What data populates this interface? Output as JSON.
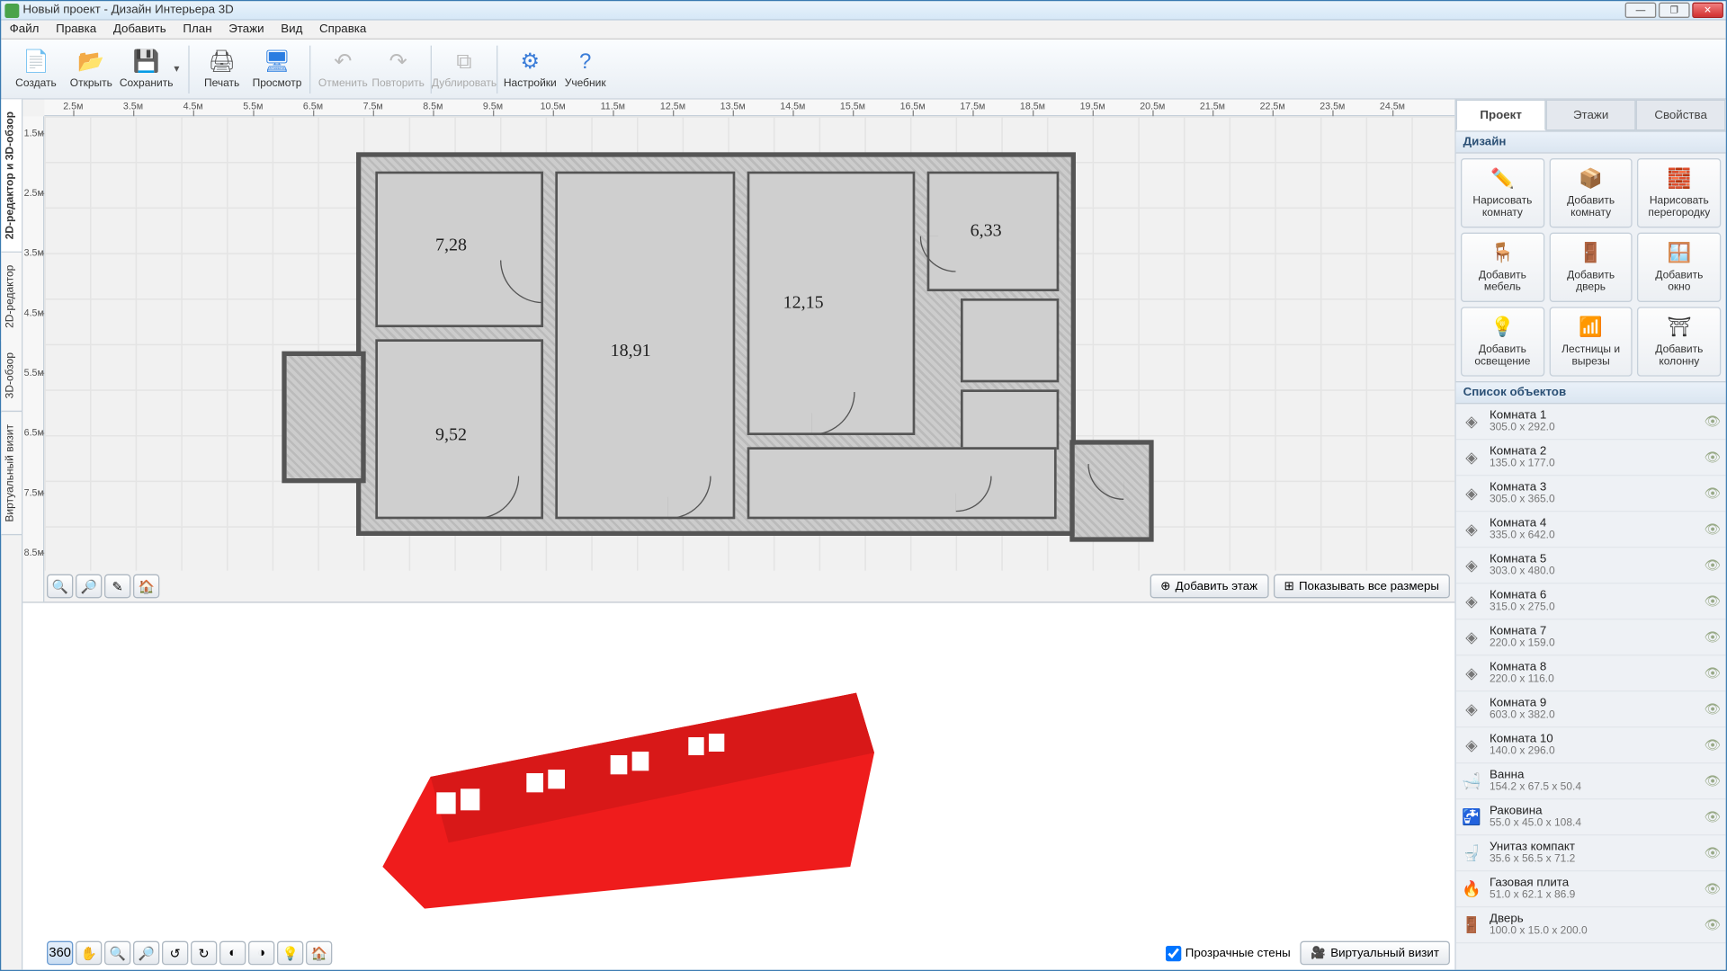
{
  "window": {
    "title": "Новый проект - Дизайн Интерьера 3D"
  },
  "menus": [
    "Файл",
    "Правка",
    "Добавить",
    "План",
    "Этажи",
    "Вид",
    "Справка"
  ],
  "toolbar": [
    {
      "id": "new",
      "label": "Создать",
      "icon": "📄",
      "color": "#2b7de1"
    },
    {
      "id": "open",
      "label": "Открыть",
      "icon": "📂",
      "color": "#e6a23c"
    },
    {
      "id": "save",
      "label": "Сохранить",
      "icon": "💾",
      "color": "#3b6fb5",
      "dropdown": true,
      "sep": true
    },
    {
      "id": "print",
      "label": "Печать",
      "icon": "🖨",
      "color": "#555"
    },
    {
      "id": "preview",
      "label": "Просмотр",
      "icon": "🖥",
      "color": "#2b7de1",
      "sep": true
    },
    {
      "id": "undo",
      "label": "Отменить",
      "icon": "↶",
      "color": "#bbb",
      "disabled": true
    },
    {
      "id": "redo",
      "label": "Повторить",
      "icon": "↷",
      "color": "#bbb",
      "disabled": true,
      "sep": true
    },
    {
      "id": "dup",
      "label": "Дублировать",
      "icon": "⧉",
      "color": "#bbb",
      "disabled": true,
      "sep": true
    },
    {
      "id": "settings",
      "label": "Настройки",
      "icon": "⚙",
      "color": "#3b7dd8"
    },
    {
      "id": "help",
      "label": "Учебник",
      "icon": "?",
      "color": "#3b7dd8"
    }
  ],
  "leftTabs": [
    {
      "id": "combined",
      "label": "2D-редактор и 3D-обзор",
      "active": true
    },
    {
      "id": "2d",
      "label": "2D-редактор"
    },
    {
      "id": "3d",
      "label": "3D-обзор"
    },
    {
      "id": "virtual",
      "label": "Виртуальный визит"
    }
  ],
  "ruler_h": [
    "2.5м",
    "3.5м",
    "4.5м",
    "5.5м",
    "6.5м",
    "7.5м",
    "8.5м",
    "9.5м",
    "10.5м",
    "11.5м",
    "12.5м",
    "13.5м",
    "14.5м",
    "15.5м",
    "16.5м",
    "17.5м",
    "18.5м",
    "19.5м",
    "20.5м",
    "21.5м",
    "22.5м",
    "23.5м",
    "24.5м"
  ],
  "ruler_v": [
    "1.5м",
    "2.5м",
    "3.5м",
    "4.5м",
    "5.5м",
    "6.5м",
    "7.5м",
    "8.5м"
  ],
  "roomAreas": {
    "r1": "7,28",
    "r2": "18,91",
    "r3": "12,15",
    "r4": "6,33",
    "r5": "9,52"
  },
  "view2dTools": {
    "addFloor": "Добавить этаж",
    "showDims": "Показывать все размеры"
  },
  "view3d": {
    "transparent": "Прозрачные стены",
    "virtual": "Виртуальный визит"
  },
  "rightTabs": [
    {
      "id": "project",
      "label": "Проект",
      "active": true
    },
    {
      "id": "floors",
      "label": "Этажи"
    },
    {
      "id": "props",
      "label": "Свойства"
    }
  ],
  "designHeader": "Дизайн",
  "designButtons": [
    {
      "id": "drawroom",
      "l1": "Нарисовать",
      "l2": "комнату",
      "icon": "✏️"
    },
    {
      "id": "addroom",
      "l1": "Добавить",
      "l2": "комнату",
      "icon": "📦"
    },
    {
      "id": "drawwall",
      "l1": "Нарисовать",
      "l2": "перегородку",
      "icon": "🧱"
    },
    {
      "id": "addfurn",
      "l1": "Добавить",
      "l2": "мебель",
      "icon": "🪑"
    },
    {
      "id": "adddoor",
      "l1": "Добавить",
      "l2": "дверь",
      "icon": "🚪"
    },
    {
      "id": "addwin",
      "l1": "Добавить",
      "l2": "окно",
      "icon": "🪟"
    },
    {
      "id": "addlight",
      "l1": "Добавить",
      "l2": "освещение",
      "icon": "💡"
    },
    {
      "id": "stairs",
      "l1": "Лестницы и",
      "l2": "вырезы",
      "icon": "📶"
    },
    {
      "id": "addcol",
      "l1": "Добавить",
      "l2": "колонну",
      "icon": "⛩"
    }
  ],
  "objectsHeader": "Список объектов",
  "objects": [
    {
      "name": "Комната 1",
      "dims": "305.0 x 292.0",
      "icon": "◈"
    },
    {
      "name": "Комната 2",
      "dims": "135.0 x 177.0",
      "icon": "◈"
    },
    {
      "name": "Комната 3",
      "dims": "305.0 x 365.0",
      "icon": "◈"
    },
    {
      "name": "Комната 4",
      "dims": "335.0 x 642.0",
      "icon": "◈"
    },
    {
      "name": "Комната 5",
      "dims": "303.0 x 480.0",
      "icon": "◈"
    },
    {
      "name": "Комната 6",
      "dims": "315.0 x 275.0",
      "icon": "◈"
    },
    {
      "name": "Комната 7",
      "dims": "220.0 x 159.0",
      "icon": "◈"
    },
    {
      "name": "Комната 8",
      "dims": "220.0 x 116.0",
      "icon": "◈"
    },
    {
      "name": "Комната 9",
      "dims": "603.0 x 382.0",
      "icon": "◈"
    },
    {
      "name": "Комната 10",
      "dims": "140.0 x 296.0",
      "icon": "◈"
    },
    {
      "name": "Ванна",
      "dims": "154.2 x 67.5 x 50.4",
      "icon": "🛁"
    },
    {
      "name": "Раковина",
      "dims": "55.0 x 45.0 x 108.4",
      "icon": "🚰"
    },
    {
      "name": "Унитаз компакт",
      "dims": "35.6 x 56.5 x 71.2",
      "icon": "🚽"
    },
    {
      "name": "Газовая плита",
      "dims": "51.0 x 62.1 x 86.9",
      "icon": "🔥"
    },
    {
      "name": "Дверь",
      "dims": "100.0 x 15.0 x 200.0",
      "icon": "🚪"
    }
  ]
}
